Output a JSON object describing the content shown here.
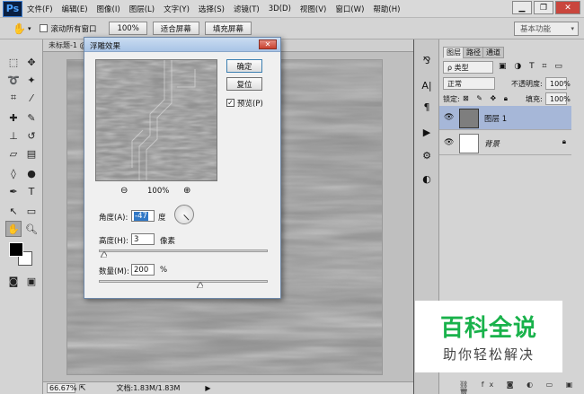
{
  "app": {
    "logo": "Ps"
  },
  "menu": [
    "文件(F)",
    "编辑(E)",
    "图像(I)",
    "图层(L)",
    "文字(Y)",
    "选择(S)",
    "滤镜(T)",
    "3D(D)",
    "视图(V)",
    "窗口(W)",
    "帮助(H)"
  ],
  "window_buttons": {
    "minimize": "▁",
    "restore": "❐",
    "close": "✕"
  },
  "options": {
    "scroll_all_label": "滚动所有窗口",
    "zoom_btn": "100%",
    "fit_btn": "适合屏幕",
    "fill_btn": "填充屏幕",
    "workspace": "基本功能"
  },
  "document": {
    "tab_title": "未标题-1 @ 66.7%"
  },
  "status": {
    "zoom": "66.67%",
    "doc_info": "文档:1.83M/1.83M"
  },
  "dialog": {
    "title": "浮雕效果",
    "ok": "确定",
    "reset": "复位",
    "preview_label": "预览(P)",
    "preview_checked": true,
    "zoom_value": "100%",
    "angle_label": "角度(A):",
    "angle_value": "-47",
    "angle_unit": "度",
    "height_label": "高度(H):",
    "height_value": "3",
    "height_unit": "像素",
    "amount_label": "数量(M):",
    "amount_value": "200",
    "amount_unit": "%",
    "height_slider_fraction": 0.03,
    "amount_slider_fraction": 0.4
  },
  "layers_panel": {
    "tabs": [
      "图层",
      "路径",
      "通道"
    ],
    "kind_filter": "ρ 类型",
    "blend_mode": "正常",
    "opacity_label": "不透明度:",
    "opacity_value": "100%",
    "lock_label": "锁定:",
    "fill_label": "填充:",
    "fill_value": "100%",
    "layers": [
      {
        "name": "图层 1",
        "selected": true
      },
      {
        "name": "背景",
        "selected": false,
        "locked": true
      }
    ]
  },
  "watermark": {
    "main": "百科全说",
    "sub": "助你轻松解决"
  },
  "colors": {
    "accent": "#19b24b",
    "layer_selected": "#a6b7d8",
    "dialog_title": "#b7cfec"
  }
}
